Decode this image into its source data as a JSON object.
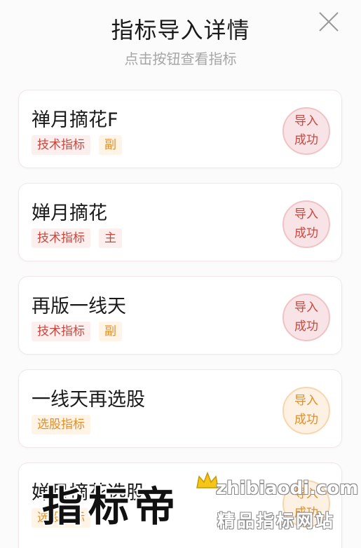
{
  "header": {
    "title": "指标导入详情",
    "subtitle": "点击按钮查看指标"
  },
  "cards": [
    {
      "name": "禅月摘花F",
      "tags": [
        {
          "text": "技术指标",
          "tone": "red"
        },
        {
          "text": "副",
          "tone": "orange"
        }
      ],
      "status_line1": "导入",
      "status_line2": "成功",
      "tone": "red"
    },
    {
      "name": "婵月摘花",
      "tags": [
        {
          "text": "技术指标",
          "tone": "red"
        },
        {
          "text": "主",
          "tone": "red"
        }
      ],
      "status_line1": "导入",
      "status_line2": "成功",
      "tone": "red"
    },
    {
      "name": "再版一线天",
      "tags": [
        {
          "text": "技术指标",
          "tone": "red"
        },
        {
          "text": "副",
          "tone": "orange"
        }
      ],
      "status_line1": "导入",
      "status_line2": "成功",
      "tone": "red"
    },
    {
      "name": "一线天再选股",
      "tags": [
        {
          "text": "选股指标",
          "tone": "orange"
        }
      ],
      "status_line1": "导入",
      "status_line2": "成功",
      "tone": "orange"
    },
    {
      "name": "婵月摘花选股",
      "tags": [
        {
          "text": "选股指标",
          "tone": "orange"
        }
      ],
      "status_line1": "导入",
      "status_line2": "成功",
      "tone": "orange"
    }
  ],
  "watermark": {
    "brand": "指标帝",
    "site": "zhibiaodi.com",
    "slogan": "精品指标网站"
  },
  "colors": {
    "red": "#c9473f",
    "orange": "#e08e2a"
  },
  "icons": {
    "close": "close-icon",
    "crown": "crown-icon"
  }
}
